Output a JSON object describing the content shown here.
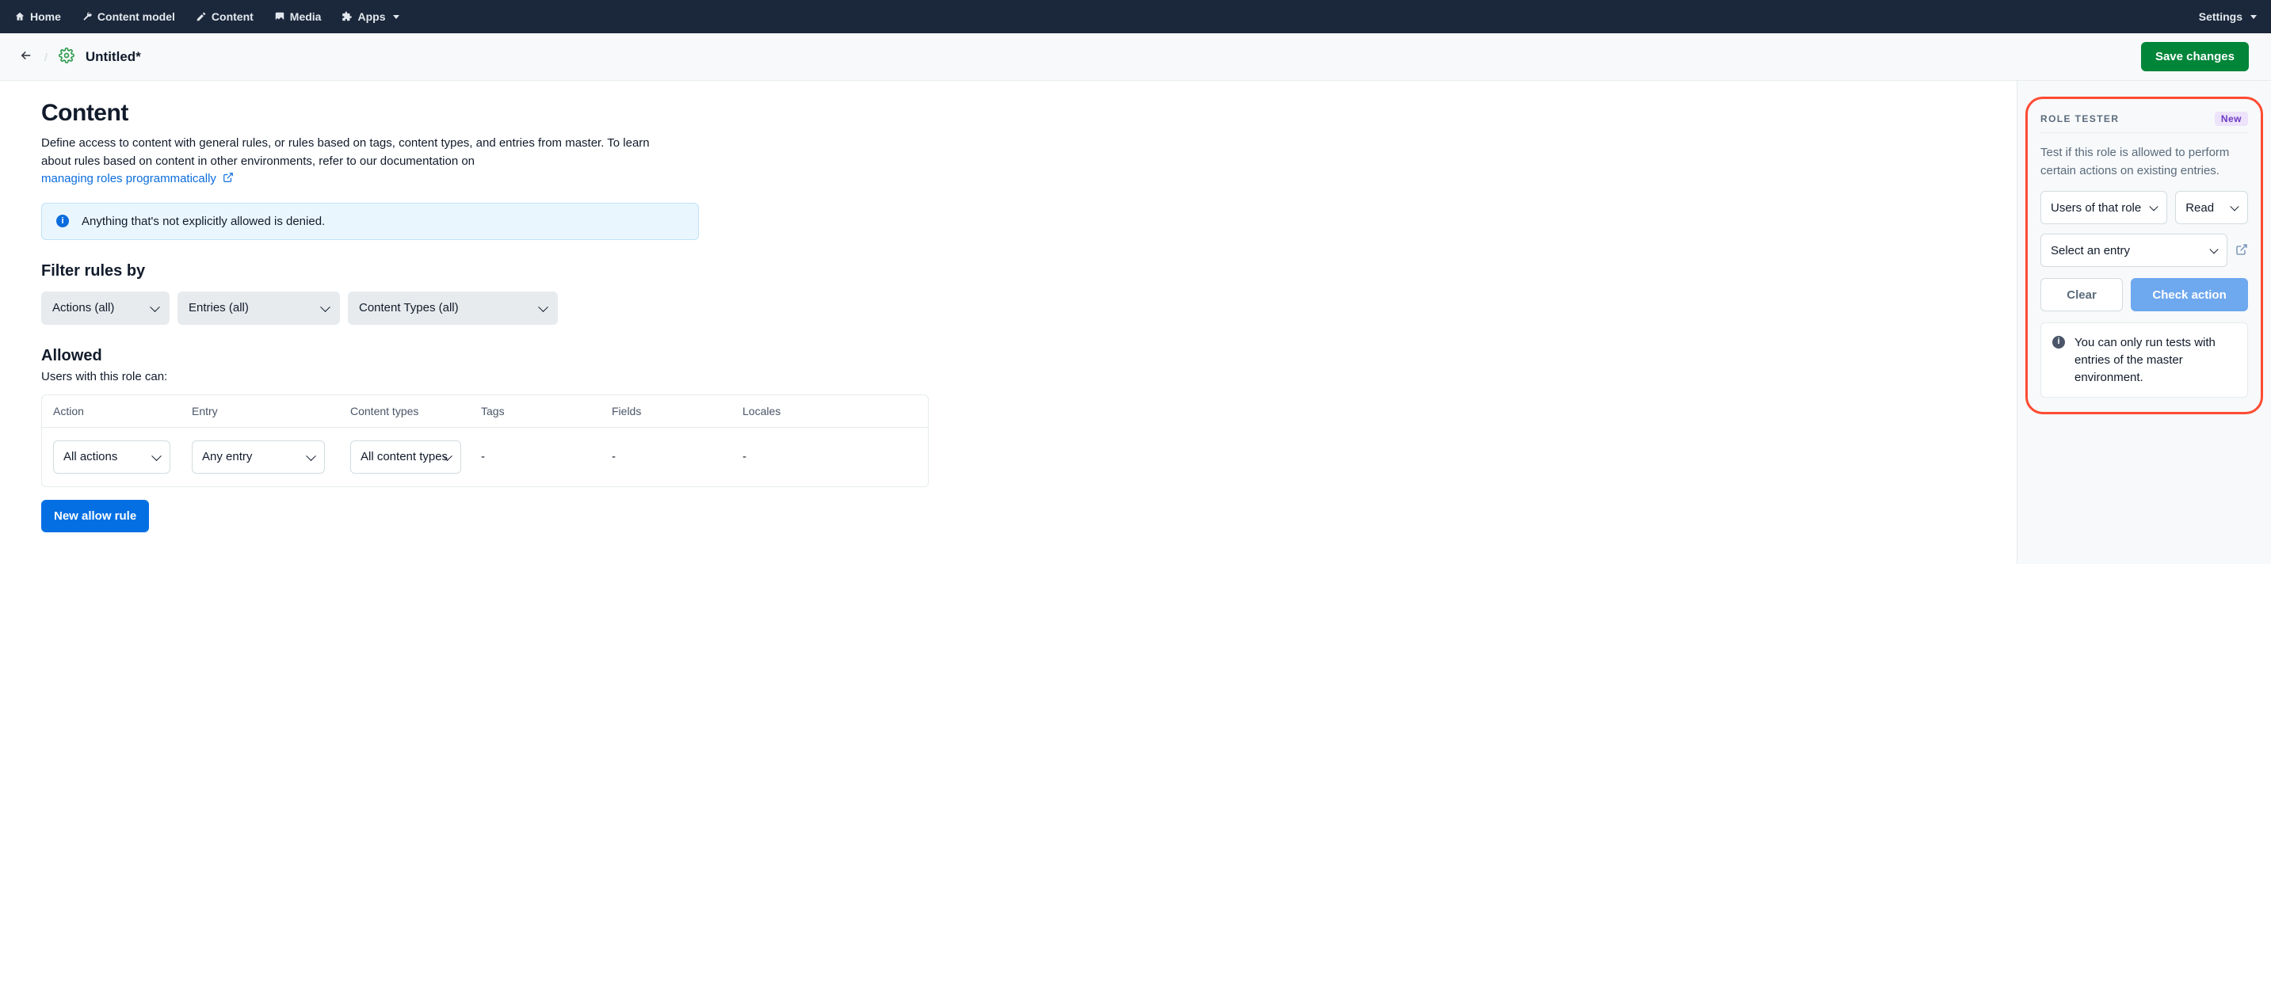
{
  "topnav": {
    "items": [
      {
        "label": "Home"
      },
      {
        "label": "Content model"
      },
      {
        "label": "Content"
      },
      {
        "label": "Media"
      },
      {
        "label": "Apps"
      }
    ],
    "settings": "Settings"
  },
  "subheader": {
    "title": "Untitled*",
    "save": "Save changes"
  },
  "page": {
    "title": "Content",
    "desc_l1": "Define access to content with general rules, or rules based on tags, content types, and entries from master. To learn",
    "desc_l2": "about rules based on content in other environments, refer to our documentation on",
    "desc_link": "managing roles programmatically",
    "banner": "Anything that's not explicitly allowed is denied."
  },
  "filter": {
    "title": "Filter rules by",
    "actions": "Actions (all)",
    "entries": "Entries (all)",
    "ctypes": "Content Types (all)"
  },
  "allowed": {
    "title": "Allowed",
    "sub": "Users with this role can:",
    "cols": {
      "action": "Action",
      "entry": "Entry",
      "ctypes": "Content types",
      "tags": "Tags",
      "fields": "Fields",
      "locales": "Locales"
    },
    "row": {
      "action": "All actions",
      "entry": "Any entry",
      "ctypes": "All content types",
      "tags": "-",
      "fields": "-",
      "locales": "-"
    },
    "new_btn": "New allow rule"
  },
  "tester": {
    "title": "Role Tester",
    "badge": "New",
    "desc": "Test if this role is allowed to perform certain actions on existing entries.",
    "users_select": "Users of that role",
    "action_select": "Read",
    "entry_select": "Select an entry",
    "clear": "Clear",
    "check": "Check action",
    "note": "You can only run tests with entries of the master environment."
  }
}
